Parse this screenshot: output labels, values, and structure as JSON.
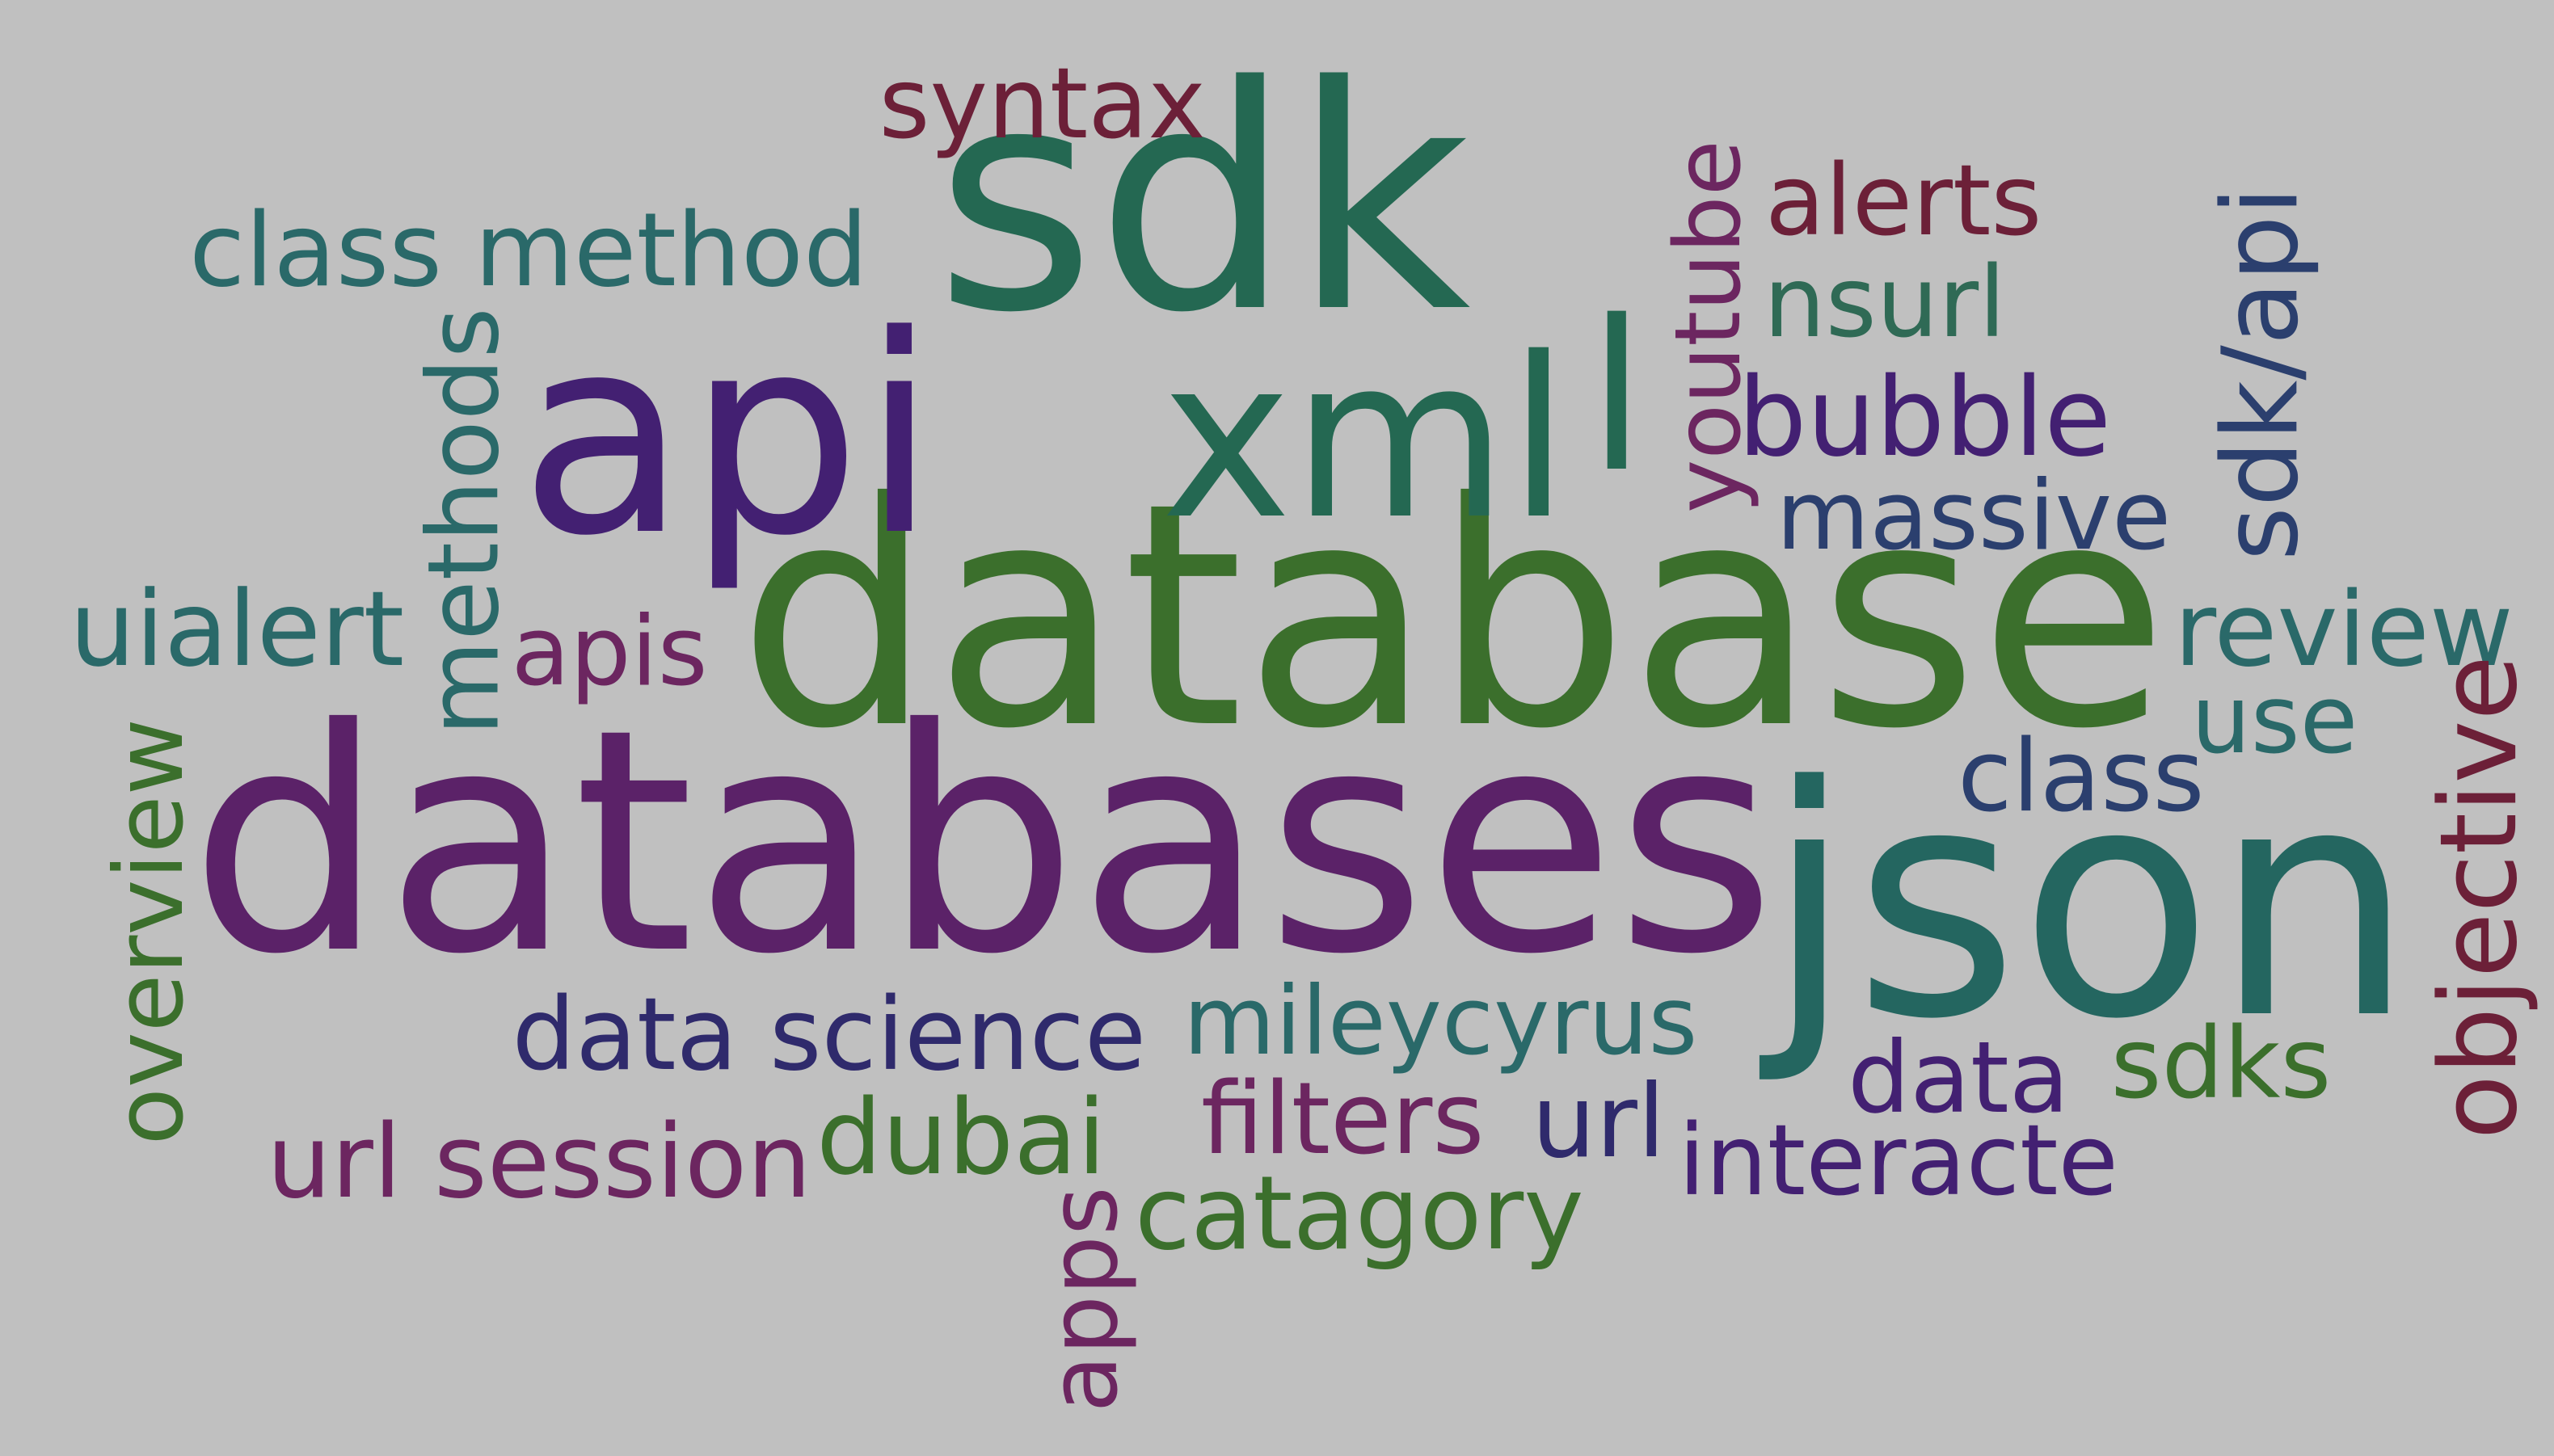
{
  "words": [
    {
      "text": "databases",
      "color": "#5b2268"
    },
    {
      "text": "database",
      "color": "#3b6f2c"
    },
    {
      "text": "api",
      "color": "#432072"
    },
    {
      "text": "sdk",
      "color": "#246852"
    },
    {
      "text": "xml",
      "color": "#246852"
    },
    {
      "text": "json",
      "color": "#246660"
    },
    {
      "text": "l",
      "color": "#246852"
    },
    {
      "text": "syntax",
      "color": "#6c2038"
    },
    {
      "text": "class method",
      "color": "#2a6969"
    },
    {
      "text": "methods",
      "color": "#2a6969"
    },
    {
      "text": "uialert",
      "color": "#2a6969"
    },
    {
      "text": "apis",
      "color": "#6c2660"
    },
    {
      "text": "overview",
      "color": "#3b6f2c"
    },
    {
      "text": "youtube",
      "color": "#6c2660"
    },
    {
      "text": "alerts",
      "color": "#6c2038"
    },
    {
      "text": "nsurl",
      "color": "#2f6a55"
    },
    {
      "text": "bubble",
      "color": "#432072"
    },
    {
      "text": "massive",
      "color": "#2b3f6e"
    },
    {
      "text": "sdk/api",
      "color": "#2b3f6e"
    },
    {
      "text": "review",
      "color": "#2a6969"
    },
    {
      "text": "use",
      "color": "#2a6969"
    },
    {
      "text": "class",
      "color": "#2b3f6e"
    },
    {
      "text": "objective",
      "color": "#6c2038"
    },
    {
      "text": "data science",
      "color": "#2f2a6c"
    },
    {
      "text": "mileycyrus",
      "color": "#2a6969"
    },
    {
      "text": "data",
      "color": "#432072"
    },
    {
      "text": "sdks",
      "color": "#3b6f2c"
    },
    {
      "text": "url session",
      "color": "#6c2660"
    },
    {
      "text": "dubai",
      "color": "#3b6f2c"
    },
    {
      "text": "filters",
      "color": "#6c2660"
    },
    {
      "text": "url",
      "color": "#2f2a6c"
    },
    {
      "text": "interacte",
      "color": "#432072"
    },
    {
      "text": "catagory",
      "color": "#3b6f2c"
    },
    {
      "text": "apps",
      "color": "#6c2660"
    }
  ]
}
